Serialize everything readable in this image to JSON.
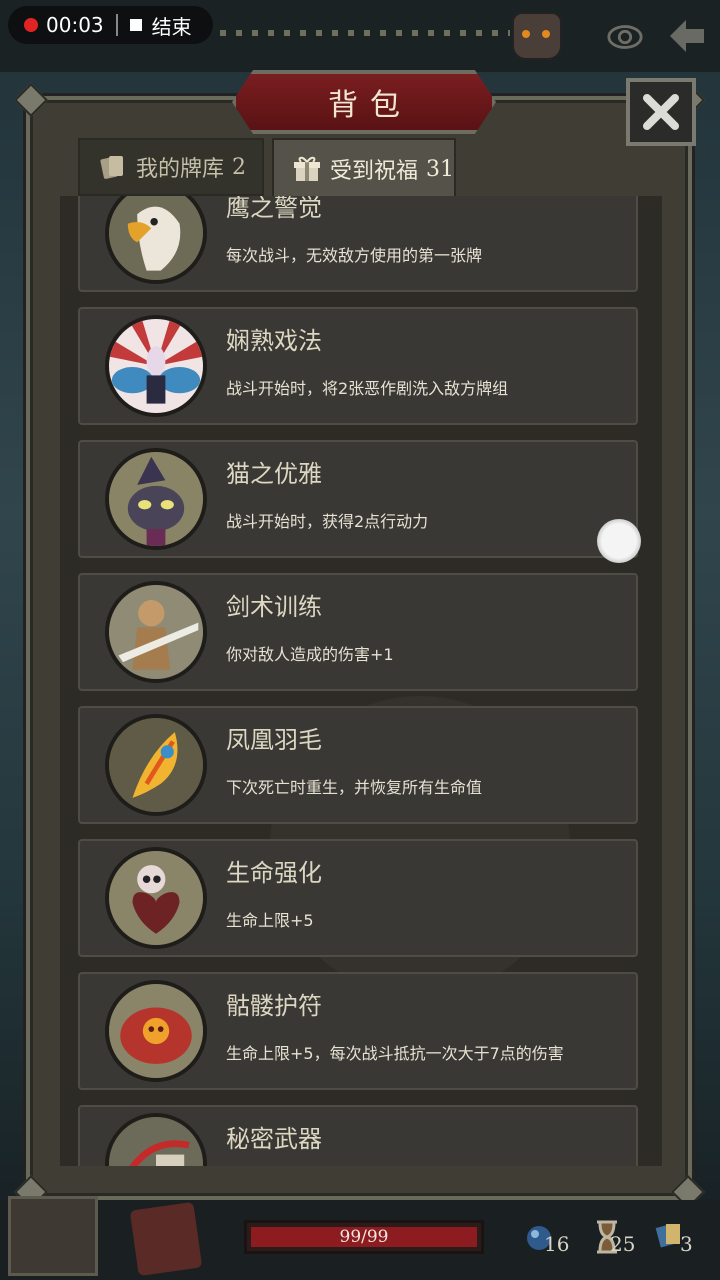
{
  "recording": {
    "time": "00:03",
    "stop_label": "结束"
  },
  "panel": {
    "title": "背包"
  },
  "tabs": [
    {
      "label": "我的牌库",
      "count": "2"
    },
    {
      "label": "受到祝福",
      "count": "31"
    }
  ],
  "blessings": [
    {
      "name": "鹰之警觉",
      "desc": "每次战斗，无效敌方使用的第一张牌",
      "icon": "eagle-icon"
    },
    {
      "name": "娴熟戏法",
      "desc": "战斗开始时，将2张恶作剧洗入敌方牌组",
      "icon": "rabbit-magician-icon"
    },
    {
      "name": "猫之优雅",
      "desc": "战斗开始时，获得2点行动力",
      "icon": "witch-cat-icon"
    },
    {
      "name": "剑术训练",
      "desc": "你对敌人造成的伤害+1",
      "icon": "swordsman-icon"
    },
    {
      "name": "凤凰羽毛",
      "desc": "下次死亡时重生，并恢复所有生命值",
      "icon": "phoenix-feather-icon"
    },
    {
      "name": "生命强化",
      "desc": "生命上限+5",
      "icon": "skull-heart-icon"
    },
    {
      "name": "骷髅护符",
      "desc": "生命上限+5，每次战斗抵抗一次大于7点的伤害",
      "icon": "skull-amulet-icon"
    },
    {
      "name": "秘密武器",
      "desc": "",
      "icon": "secret-weapon-icon"
    }
  ],
  "hud": {
    "hp_text": "99/99",
    "hp_fraction": 1.0,
    "mana": "16",
    "turns": "25",
    "cards": "3"
  },
  "colors": {
    "ribbon": "#6a1719",
    "hp": "#8c1c20"
  }
}
